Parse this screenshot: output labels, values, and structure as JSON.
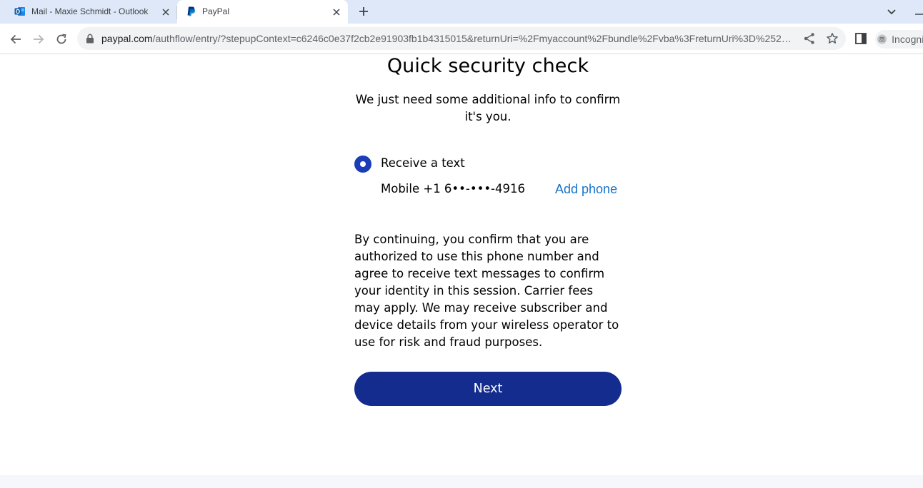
{
  "browser": {
    "tabs": [
      {
        "title": "Mail - Maxie Schmidt - Outlook",
        "icon": "outlook-icon",
        "active": false
      },
      {
        "title": "PayPal",
        "icon": "paypal-icon",
        "active": true
      }
    ],
    "address_bar": {
      "host": "paypal.com",
      "path": "/authflow/entry/?stepupContext=c6246c0e37f2cb2e91903fb1b4315015&returnUri=%2Fmyaccount%2Fbundle%2Fvba%3FreturnUri%3D%252…"
    },
    "profile_label": "Incognito"
  },
  "page": {
    "heading": "Quick security check",
    "subtext": "We just need some additional info to confirm it's you.",
    "option": {
      "label": "Receive a text",
      "selected": true,
      "mobile": "Mobile +1 6••-•••-4916",
      "add_phone": "Add phone"
    },
    "consent": "By continuing, you confirm that you are authorized to use this phone number and agree to receive text messages to confirm your identity in this session. Carrier fees may apply. We may receive subscriber and device details from your wireless operator to use for risk and fraud purposes.",
    "next_label": "Next"
  },
  "colors": {
    "tabstrip": "#dee8f8",
    "radio": "#1a3db8",
    "button": "#142c8e",
    "link": "#1a73c8"
  }
}
